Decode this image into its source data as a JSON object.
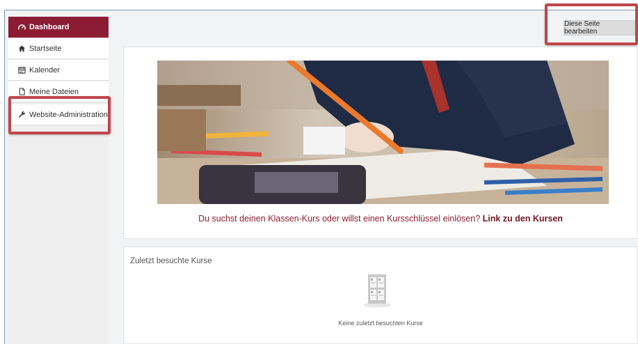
{
  "sidebar": {
    "items": [
      {
        "label": "Dashboard",
        "icon": "dashboard-icon"
      },
      {
        "label": "Startseite",
        "icon": "home-icon"
      },
      {
        "label": "Kalender",
        "icon": "calendar-icon"
      },
      {
        "label": "Meine Dateien",
        "icon": "file-icon"
      },
      {
        "label": "Website-Administration",
        "icon": "wrench-icon"
      }
    ]
  },
  "header": {
    "edit_button": "Diese Seite bearbeiten"
  },
  "hero": {
    "caption_text": "Du suchst deinen Klassen-Kurs oder willst einen Kursschlüssel einlösen? ",
    "caption_link": "Link zu den Kursen"
  },
  "recent": {
    "title": "Zuletzt besuchte Kurse",
    "empty_text": "Keine zuletzt besuchten Kurse",
    "icon": "courses-grid-icon"
  },
  "colors": {
    "brand": "#8c1c33",
    "highlight": "#c0464b"
  }
}
